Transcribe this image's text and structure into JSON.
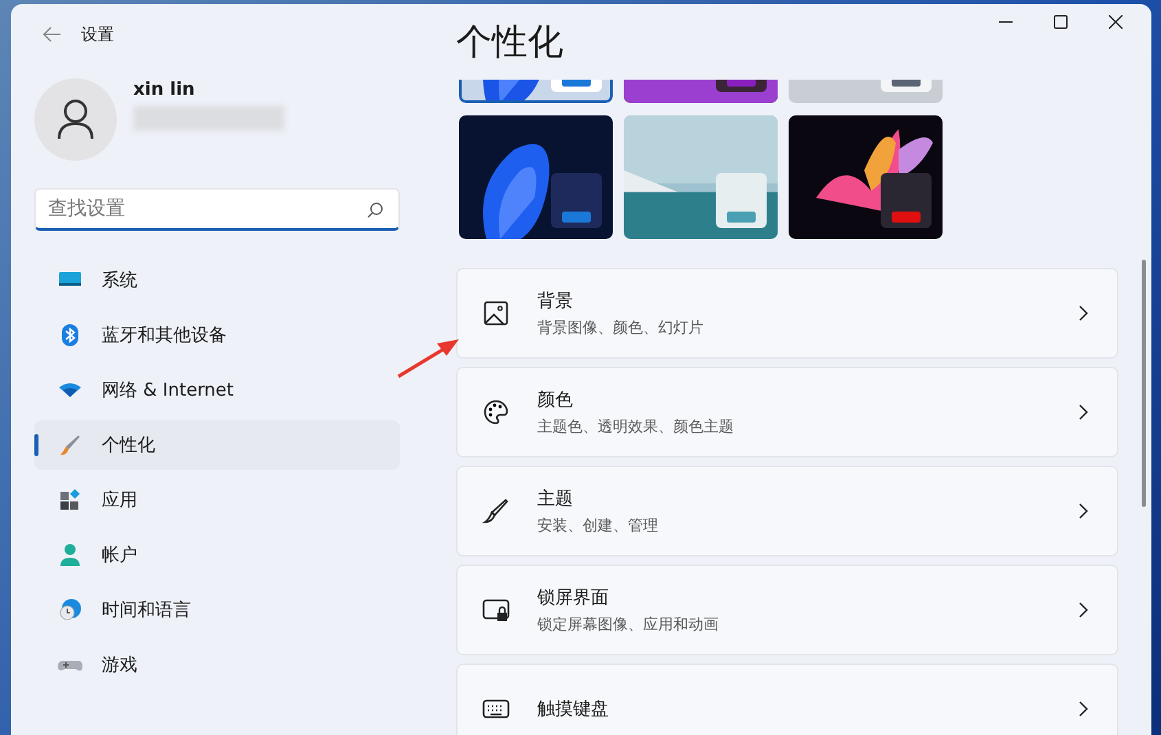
{
  "window": {
    "title": "设置"
  },
  "account": {
    "name": "xin lin"
  },
  "search": {
    "placeholder": "查找设置"
  },
  "sidebar": {
    "items": [
      {
        "label": "系统",
        "selected": false
      },
      {
        "label": "蓝牙和其他设备",
        "selected": false
      },
      {
        "label": "网络 & Internet",
        "selected": false
      },
      {
        "label": "个性化",
        "selected": true
      },
      {
        "label": "应用",
        "selected": false
      },
      {
        "label": "帐户",
        "selected": false
      },
      {
        "label": "时间和语言",
        "selected": false
      },
      {
        "label": "游戏",
        "selected": false
      }
    ]
  },
  "page": {
    "title": "个性化"
  },
  "themes": [
    {
      "kind": "picture",
      "selected": true
    },
    {
      "kind": "picture",
      "selected": false
    },
    {
      "kind": "picture",
      "selected": false
    },
    {
      "kind": "picture",
      "selected": false
    },
    {
      "kind": "picture",
      "selected": false
    },
    {
      "kind": "picture",
      "selected": false
    }
  ],
  "settings": [
    {
      "title": "背景",
      "subtitle": "背景图像、颜色、幻灯片"
    },
    {
      "title": "颜色",
      "subtitle": "主题色、透明效果、颜色主题"
    },
    {
      "title": "主题",
      "subtitle": "安装、创建、管理"
    },
    {
      "title": "锁屏界面",
      "subtitle": "锁定屏幕图像、应用和动画"
    },
    {
      "title": "触摸键盘"
    }
  ]
}
